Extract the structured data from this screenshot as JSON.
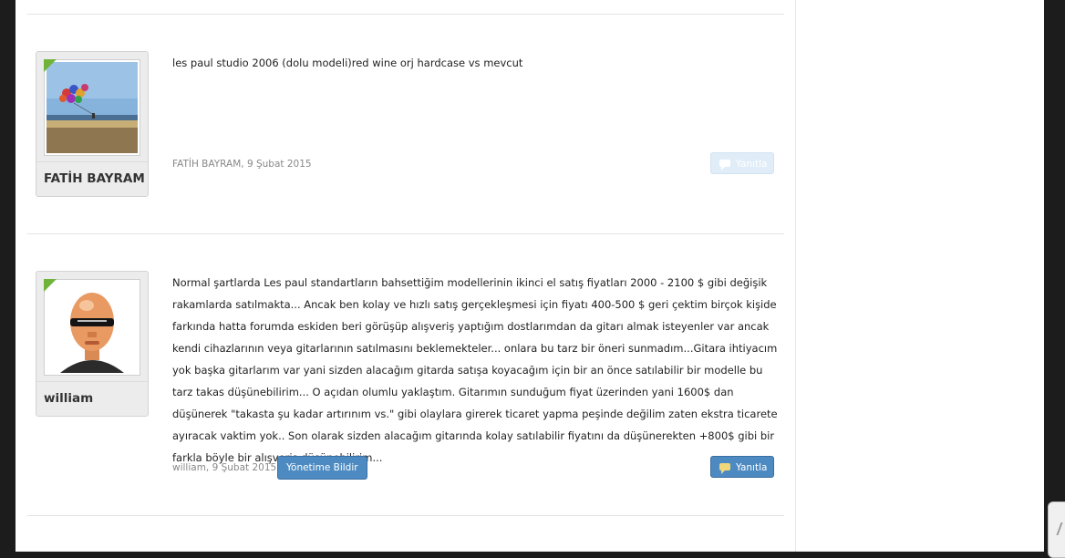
{
  "posts": [
    {
      "username": "FATİH BAYRAM",
      "avatar": "balloons-photo",
      "message": "les paul studio 2006 (dolu modeli)red wine orj hardcase vs mevcut",
      "meta": "FATİH BAYRAM, 9 Şubat 2015",
      "reply_label": "Yanıtla",
      "reply_state": "disabled"
    },
    {
      "username": "william",
      "avatar": "bald-man-sunglasses-photo",
      "message": "Normal şartlarda Les paul standartların bahsettiğim modellerinin ikinci el satış fiyatları 2000 - 2100 $ gibi değişik rakamlarda satılmakta... Ancak ben kolay ve hızlı satış gerçekleşmesi için fiyatı 400-500 $ geri çektim birçok kişide farkında hatta forumda eskiden beri görüşüp alışveriş yaptığım dostlarımdan da gitarı almak isteyenler var ancak kendi cihazlarının veya gitarlarının satılmasını beklemekteler... onlara bu tarz bir öneri sunmadım...Gitara ihtiyacım yok başka gitarlarım var yani sizden alacağım gitarda satışa koyacağım için bir an önce satılabilir bir modelle bu tarz takas düşünebilirim... O açıdan olumlu yaklaştım. Gitarımın sunduğum fiyat üzerinden yani 1600$ dan düşünerek \"takasta şu kadar artırınım vs.\" gibi olaylara girerek ticaret yapma peşinde değilim zaten ekstra ticarete ayıracak vaktim yok.. Son olarak sizden alacağım gitarında kolay satılabilir fiyatını da düşünerekten +800$ gibi bir farkla böyle bir alışveriş düşünebilirim...",
      "meta": "william, 9 Şubat 2015",
      "report_label": "Yönetime Bildir",
      "reply_label": "Yanıtla",
      "reply_state": "enabled"
    }
  ],
  "colors": {
    "accent_blue": "#4d8ac2",
    "badge_green": "#6fb33a",
    "page_bg": "#1c1c1c"
  }
}
